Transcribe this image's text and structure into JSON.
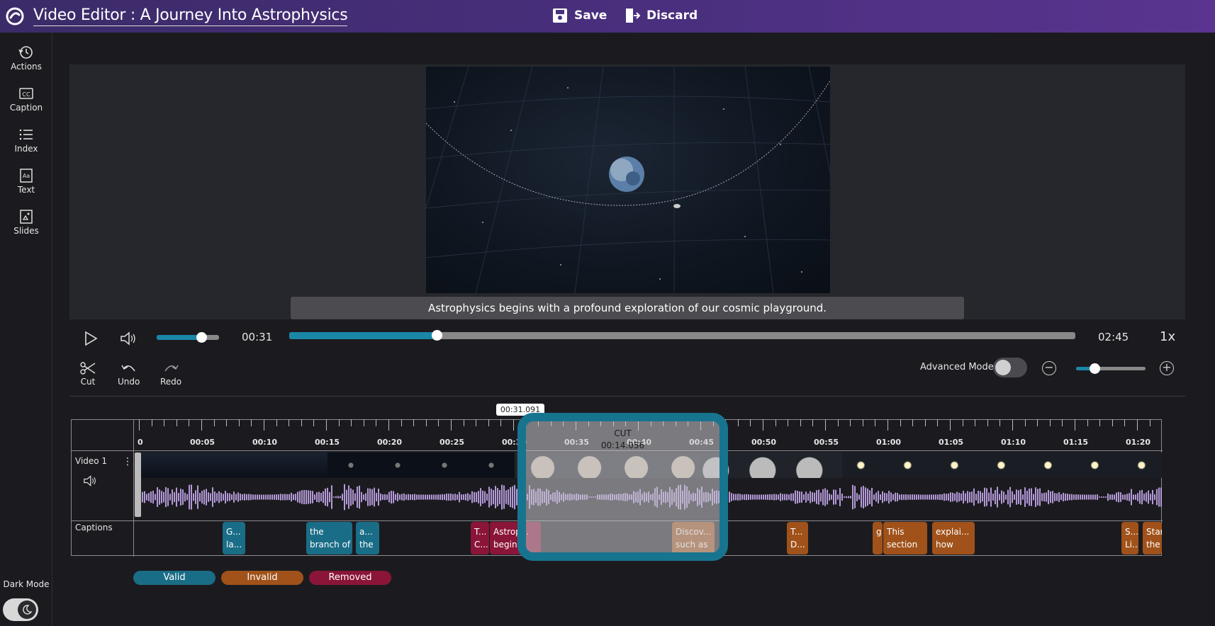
{
  "header": {
    "title": "Video Editor : A Journey Into Astrophysics",
    "save_label": "Save",
    "discard_label": "Discard"
  },
  "sidebar": {
    "items": [
      {
        "label": "Actions",
        "icon": "history-icon"
      },
      {
        "label": "Caption",
        "icon": "closed-caption-icon"
      },
      {
        "label": "Index",
        "icon": "list-icon"
      },
      {
        "label": "Text",
        "icon": "text-icon"
      },
      {
        "label": "Slides",
        "icon": "slides-icon"
      }
    ],
    "dark_mode_label": "Dark Mode",
    "dark_mode_on": true
  },
  "player": {
    "caption_text": "Astrophysics begins with a profound exploration of our cosmic playground.",
    "current_time": "00:31",
    "duration": "02:45",
    "speed": "1x",
    "volume_fraction": 0.72,
    "progress_fraction": 0.188
  },
  "tools": {
    "cut_label": "Cut",
    "undo_label": "Undo",
    "redo_label": "Redo",
    "advanced_mode_label": "Advanced Mode",
    "advanced_mode_on": false,
    "zoom_fraction": 0.27
  },
  "timeline": {
    "playhead_time": "00:31.091",
    "video_track_label": "Video 1",
    "captions_track_label": "Captions",
    "ruler_labels": [
      "0",
      "00:05",
      "00:10",
      "00:15",
      "00:20",
      "00:25",
      "00:30",
      "00:35",
      "00:40",
      "00:45",
      "00:50",
      "00:55",
      "01:00",
      "01:05",
      "01:10",
      "01:15",
      "01:20"
    ],
    "cut_title": "CUT",
    "cut_duration": "00:14.056",
    "captions": [
      {
        "line1": "G...",
        "line2": "la...",
        "status": "valid"
      },
      {
        "line1": "the",
        "line2": "branch of",
        "status": "valid"
      },
      {
        "line1": "a...",
        "line2": "the",
        "status": "valid"
      },
      {
        "line1": "T...",
        "line2": "C...",
        "status": "removed"
      },
      {
        "line1": "Astrop...",
        "line2": "begin",
        "status": "removed"
      },
      {
        "line1": "Discov...",
        "line2": "such as",
        "status": "invalid"
      },
      {
        "line1": "T...",
        "line2": "D...",
        "status": "invalid"
      },
      {
        "line1": "g...",
        "line2": "",
        "status": "invalid"
      },
      {
        "line1": "This",
        "line2": "section",
        "status": "invalid"
      },
      {
        "line1": "explai...",
        "line2": "how",
        "status": "invalid"
      },
      {
        "line1": "S...",
        "line2": "Li...",
        "status": "invalid"
      },
      {
        "line1": "Star",
        "line2": "the",
        "status": "invalid"
      }
    ]
  },
  "legend": {
    "valid": "Valid",
    "invalid": "Invalid",
    "removed": "Removed"
  },
  "colors": {
    "accent": "#1a87a7",
    "valid": "#1a6d86",
    "invalid": "#a0521a",
    "removed": "#8a1538",
    "waveform": "#b49ad8"
  }
}
